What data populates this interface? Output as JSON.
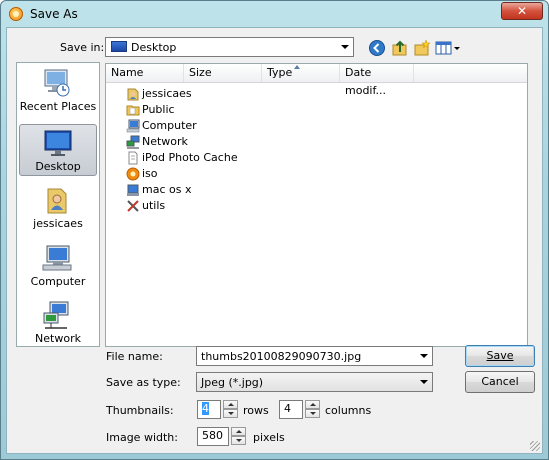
{
  "window": {
    "title": "Save As",
    "close_label": "✕"
  },
  "toolbar": {
    "save_in_label": "Save in:",
    "save_in_value": "Desktop"
  },
  "places": [
    {
      "label": "Recent Places",
      "icon": "recent-places-icon"
    },
    {
      "label": "Desktop",
      "icon": "desktop-icon",
      "selected": true
    },
    {
      "label": "jessicaes",
      "icon": "user-folder-icon"
    },
    {
      "label": "Computer",
      "icon": "computer-icon"
    },
    {
      "label": "Network",
      "icon": "network-icon"
    }
  ],
  "columns": [
    {
      "label": "Name"
    },
    {
      "label": "Size"
    },
    {
      "label": "Type"
    },
    {
      "label": "Date modif..."
    }
  ],
  "files": [
    {
      "name": "jessicaes",
      "icon": "user-folder-icon"
    },
    {
      "name": "Public",
      "icon": "folder-icon"
    },
    {
      "name": "Computer",
      "icon": "computer-icon"
    },
    {
      "name": "Network",
      "icon": "network-icon"
    },
    {
      "name": "iPod Photo Cache",
      "icon": "document-icon"
    },
    {
      "name": "iso",
      "icon": "app-icon"
    },
    {
      "name": "mac os x",
      "icon": "mac-icon"
    },
    {
      "name": "utils",
      "icon": "tools-icon"
    }
  ],
  "form": {
    "file_name_label": "File name:",
    "file_name_value": "thumbs20100829090730.jpg",
    "save_type_label": "Save as type:",
    "save_type_value": "Jpeg (*.jpg)",
    "thumbnails_label": "Thumbnails:",
    "rows_value": "4",
    "rows_label": "rows",
    "columns_value": "4",
    "columns_label": "columns",
    "image_width_label": "Image width:",
    "image_width_value": "580",
    "pixels_label": "pixels"
  },
  "buttons": {
    "save": "Save",
    "cancel": "Cancel"
  }
}
